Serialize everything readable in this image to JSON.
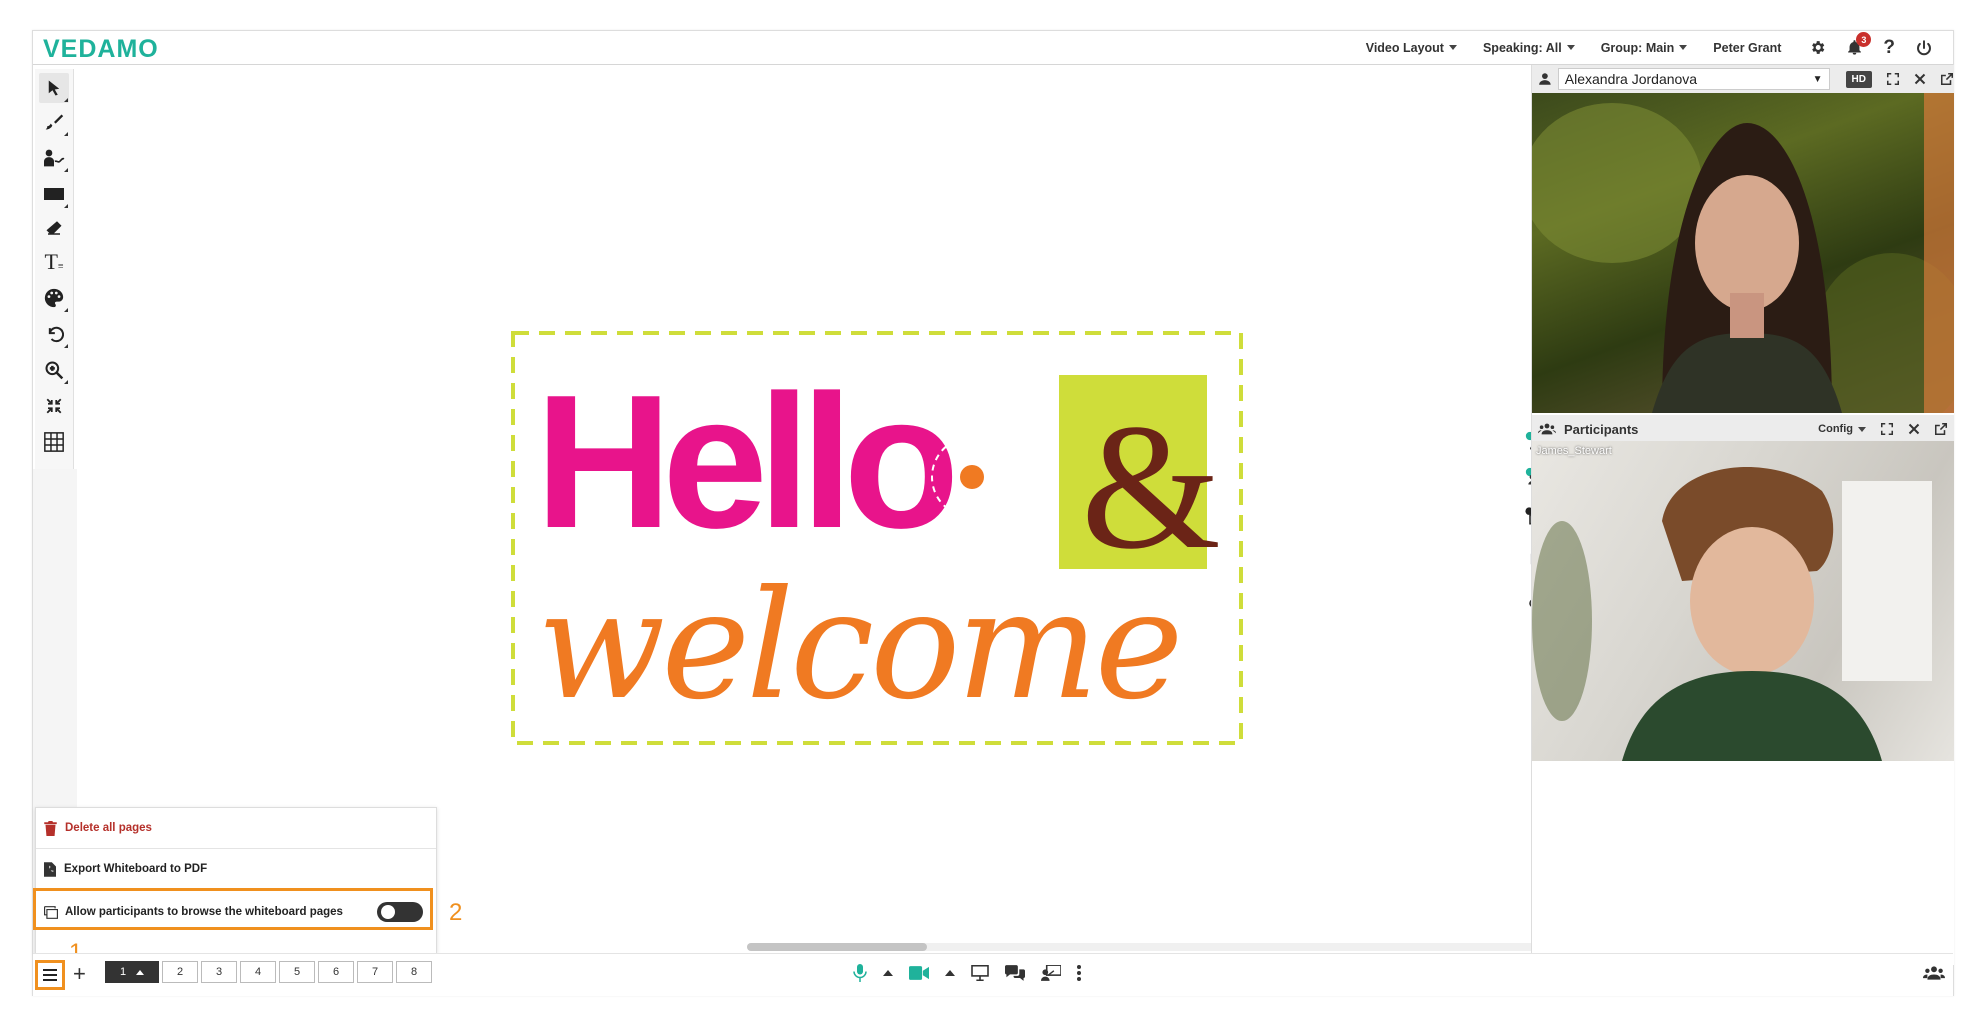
{
  "app": {
    "logo": "VEDAMO",
    "brand_color": "#1fb29b",
    "accent_color": "#f0901e"
  },
  "topbar": {
    "video_layout": "Video Layout",
    "speaking": "Speaking: All",
    "group": "Group: Main",
    "user": "Peter Grant",
    "notification_count": "3"
  },
  "toolbar": {
    "tools": [
      "select-icon",
      "brush-icon",
      "presenter-pen-icon",
      "rectangle-icon",
      "eraser-icon",
      "text-icon",
      "palette-icon",
      "undo-icon",
      "zoom-icon",
      "fit-icon",
      "grid-icon"
    ]
  },
  "canvas": {
    "image": "hello-welcome-graphic",
    "line1": "Hello",
    "ampersand": "&",
    "line2": "welcome"
  },
  "right_panel": {
    "video1": {
      "selected_user": "Alexandra Jordanova",
      "quality": "HD"
    },
    "participants": {
      "title": "Participants",
      "config": "Config",
      "video_name": "James_Stewart"
    }
  },
  "popup": {
    "delete_all": "Delete all pages",
    "export_pdf": "Export Whiteboard to PDF",
    "allow_browse": "Allow participants to browse the whiteboard pages",
    "allow_browse_enabled": false
  },
  "callouts": {
    "one": "1",
    "two": "2"
  },
  "bottombar": {
    "pages": [
      "1",
      "2",
      "3",
      "4",
      "5",
      "6",
      "7",
      "8"
    ],
    "active_page": "1"
  }
}
